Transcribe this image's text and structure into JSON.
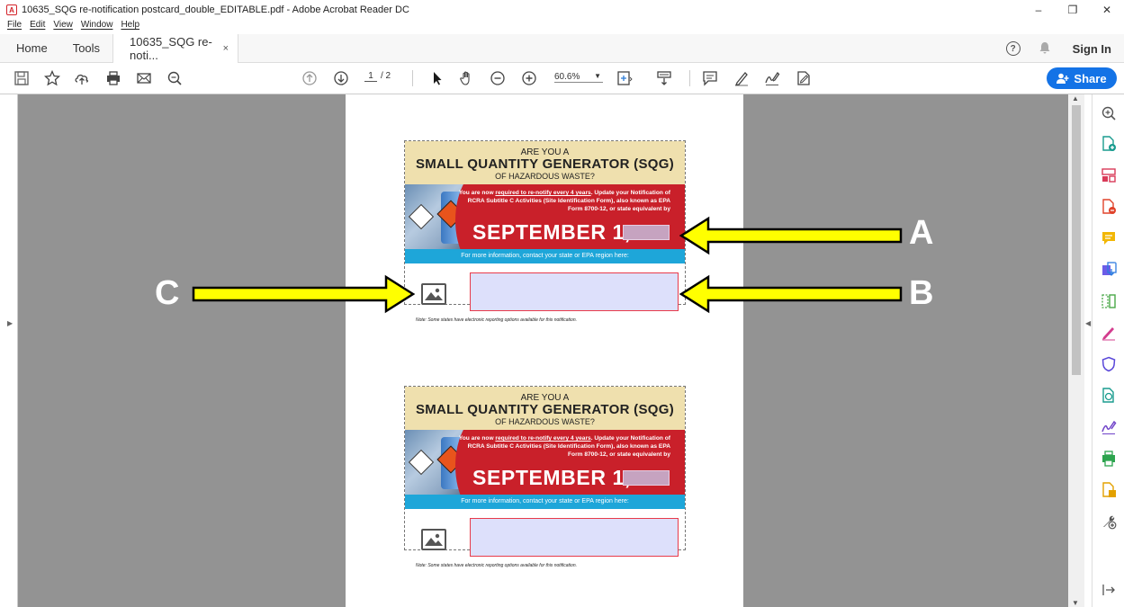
{
  "window": {
    "title": "10635_SQG re-notification postcard_double_EDITABLE.pdf - Adobe Acrobat Reader DC",
    "minimize": "–",
    "restore": "❐",
    "close": "✕"
  },
  "menu": [
    "File",
    "Edit",
    "View",
    "Window",
    "Help"
  ],
  "tabs": {
    "home": "Home",
    "tools": "Tools",
    "doc": "10635_SQG re-noti...",
    "doc_close": "×"
  },
  "header": {
    "help": "?",
    "signin": "Sign In"
  },
  "toolbar": {
    "page_current": "1",
    "page_total": "/ 2",
    "zoom": "60.6%",
    "share_label": "Share"
  },
  "postcard": {
    "line1": "ARE YOU A",
    "line2": "SMALL QUANTITY GENERATOR (SQG)",
    "line3": "OF HAZARDOUS WASTE?",
    "body_prefix": "You are now ",
    "body_underlined": "required to re-notify every 4 years",
    "body_suffix": ". Update your Notification of RCRA Subtitle C Activities (Site Identification Form), also known as EPA Form 8700-12, or state equivalent by",
    "deadline": "SEPTEMBER 1,",
    "info": "For more information, contact your state or EPA region here:",
    "note": "Note: Some states have electronic reporting options available for this notification."
  },
  "callouts": {
    "a": "A",
    "b": "B",
    "c": "C"
  },
  "colors": {
    "accent": "#1473e6",
    "banner_red": "#c9202a",
    "header_tan": "#efe0ae",
    "info_blue": "#1ea6d9",
    "field_fill": "#dde0fb",
    "arrow_yellow": "#ffff00"
  }
}
